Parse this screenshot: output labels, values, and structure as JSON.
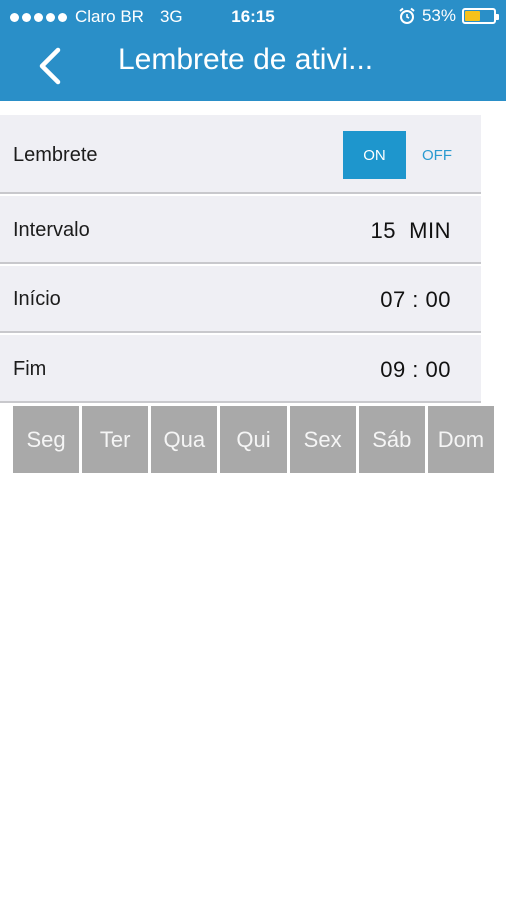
{
  "status_bar": {
    "carrier": "Claro BR",
    "network": "3G",
    "time": "16:15",
    "battery": "53%",
    "battery_level": 0.53,
    "alarm_icon": "alarm-clock-icon"
  },
  "nav": {
    "title": "Lembrete de ativi...",
    "back_icon": "chevron-left-icon"
  },
  "reminder": {
    "label": "Lembrete",
    "on_label": "ON",
    "off_label": "OFF",
    "state": "ON"
  },
  "interval": {
    "label": "Intervalo",
    "value": "15  MIN"
  },
  "start": {
    "label": "Início",
    "value": "07 : 00"
  },
  "end": {
    "label": "Fim",
    "value": "09 : 00"
  },
  "days": [
    "Seg",
    "Ter",
    "Qua",
    "Qui",
    "Sex",
    "Sáb",
    "Dom"
  ],
  "colors": {
    "header": "#2a8fc8",
    "toggle_active": "#1e96cd",
    "day_inactive": "#a9a9a9"
  }
}
